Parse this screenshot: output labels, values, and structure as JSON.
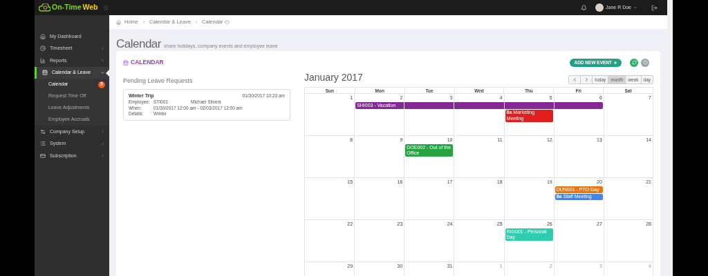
{
  "topbar": {
    "logo_part_1": "On-Time",
    "logo_part_2": "Web",
    "user": "Jane R Doe"
  },
  "sidebar": {
    "items": [
      {
        "label": "My Dashboard",
        "expandable": false,
        "selected": false
      },
      {
        "label": "Timesheet",
        "expandable": true,
        "expanded": false,
        "selected": false
      },
      {
        "label": "Reports",
        "expandable": true,
        "expanded": false,
        "selected": false
      },
      {
        "label": "Calendar & Leave",
        "expandable": true,
        "expanded": true,
        "selected": true,
        "children": [
          {
            "label": "Calendar",
            "selected": true,
            "badge": "5"
          },
          {
            "label": "Request Time Off",
            "selected": false
          },
          {
            "label": "Leave Adjustments",
            "selected": false
          },
          {
            "label": "Employee Accruals",
            "selected": false
          }
        ]
      },
      {
        "label": "Company Setup",
        "expandable": true,
        "expanded": false,
        "selected": false
      },
      {
        "label": "System",
        "expandable": true,
        "expanded": false,
        "selected": false
      },
      {
        "label": "Subscription",
        "expandable": true,
        "expanded": false,
        "selected": false
      }
    ]
  },
  "breadcrumb": [
    "Home",
    "Calendar & Leave",
    "Calendar"
  ],
  "page": {
    "title": "Calendar",
    "subtitle": "share holidays, company events and employee leave"
  },
  "card": {
    "title": "CALENDAR",
    "add_button": "ADD NEW EVENT"
  },
  "pending": {
    "title": "Pending Leave Requests",
    "requests": [
      {
        "title": "Winter Trip",
        "timestamp": "01/30/2017 10:23 am",
        "fields": [
          {
            "label": "Employee:",
            "value": "STI001",
            "extra": "Michael Stivers"
          },
          {
            "label": "When:",
            "value": "01/30/2017 12:00 am - 02/03/2017 12:00 am"
          },
          {
            "label": "Details:",
            "value": "Winter"
          }
        ]
      }
    ]
  },
  "calendar": {
    "title": "January 2017",
    "view_buttons": [
      {
        "label": "today",
        "selected": false
      },
      {
        "label": "month",
        "selected": true
      },
      {
        "label": "week",
        "selected": false
      },
      {
        "label": "day",
        "selected": false
      }
    ],
    "weekdays": [
      "Sun",
      "Mon",
      "Tue",
      "Wed",
      "Thu",
      "Fri",
      "Sat"
    ],
    "weeks": [
      {
        "days": [
          {
            "number": "1",
            "other_month": false
          },
          {
            "number": "2",
            "other_month": false,
            "events": [
              {
                "kind": "start",
                "label": "SHI003 - Vacation",
                "color": "#842993"
              }
            ]
          },
          {
            "number": "3",
            "other_month": false,
            "events": [
              {
                "kind": "continued",
                "color": "#842993"
              }
            ]
          },
          {
            "number": "4",
            "other_month": false,
            "events": [
              {
                "kind": "continued",
                "color": "#842993"
              }
            ]
          },
          {
            "number": "5",
            "other_month": false,
            "events": [
              {
                "kind": "continued",
                "color": "#842993"
              },
              {
                "kind": "single",
                "time": "8a",
                "label": "Marketing Meeting",
                "color": "#e01e1e"
              }
            ]
          },
          {
            "number": "6",
            "other_month": false,
            "events": [
              {
                "kind": "end",
                "color": "#842993"
              }
            ]
          },
          {
            "number": "7",
            "other_month": false
          }
        ]
      },
      {
        "days": [
          {
            "number": "8",
            "other_month": false
          },
          {
            "number": "9",
            "other_month": false
          },
          {
            "number": "10",
            "other_month": false,
            "events": [
              {
                "kind": "single",
                "label": "DOE002 - Out of the Office",
                "color": "#27a243"
              }
            ]
          },
          {
            "number": "11",
            "other_month": false
          },
          {
            "number": "12",
            "other_month": false
          },
          {
            "number": "13",
            "other_month": false
          },
          {
            "number": "14",
            "other_month": false
          }
        ]
      },
      {
        "days": [
          {
            "number": "15",
            "other_month": false
          },
          {
            "number": "16",
            "other_month": false
          },
          {
            "number": "17",
            "other_month": false
          },
          {
            "number": "18",
            "other_month": false
          },
          {
            "number": "19",
            "other_month": false
          },
          {
            "number": "20",
            "other_month": false,
            "events": [
              {
                "kind": "single",
                "label": "DUN001 - PTO Day",
                "color": "#e8780c"
              },
              {
                "kind": "single",
                "time": "8a",
                "label": "Staff Meeting",
                "color": "#3b86ef"
              }
            ]
          },
          {
            "number": "21",
            "other_month": false
          }
        ]
      },
      {
        "days": [
          {
            "number": "22",
            "other_month": false
          },
          {
            "number": "23",
            "other_month": false
          },
          {
            "number": "24",
            "other_month": false
          },
          {
            "number": "25",
            "other_month": false
          },
          {
            "number": "26",
            "other_month": false,
            "events": [
              {
                "kind": "single",
                "label": "RIG001 - Personal Day",
                "color": "#2fcdb0"
              }
            ]
          },
          {
            "number": "27",
            "other_month": false
          },
          {
            "number": "28",
            "other_month": false
          }
        ]
      },
      {
        "days": [
          {
            "number": "29",
            "other_month": false
          },
          {
            "number": "30",
            "other_month": false
          },
          {
            "number": "31",
            "other_month": false
          },
          {
            "number": "1",
            "other_month": true
          },
          {
            "number": "2",
            "other_month": true
          },
          {
            "number": "3",
            "other_month": true
          },
          {
            "number": "4",
            "other_month": true
          }
        ]
      }
    ]
  }
}
